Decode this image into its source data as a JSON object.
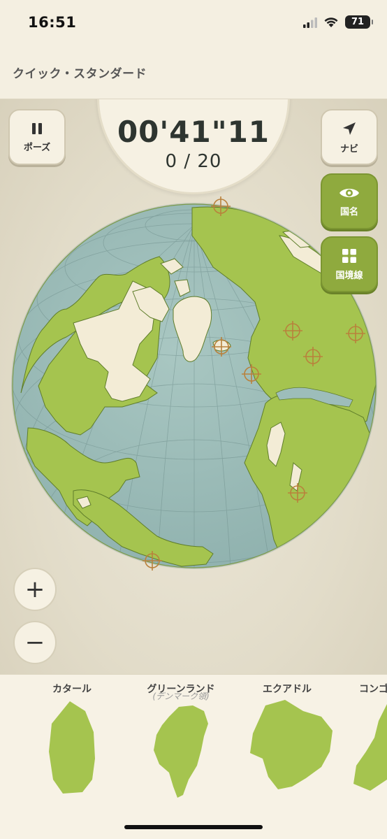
{
  "status_bar": {
    "time": "16:51",
    "battery": "71",
    "icons": [
      "signal-icon",
      "wifi-icon",
      "battery-icon"
    ]
  },
  "header": {
    "mode_title": "クイック・スタンダード"
  },
  "game": {
    "timer": "00'41\"11",
    "progress": "0 / 20",
    "pause_label": "ポーズ",
    "navi_label": "ナビ",
    "country_names_label": "国名",
    "borders_label": "国境線",
    "zoom_in": "+",
    "zoom_out": "−"
  },
  "tray": {
    "cards": [
      {
        "name": "カタール",
        "sub": ""
      },
      {
        "name": "グリーンランド",
        "sub": "(デンマーク領)"
      },
      {
        "name": "エクアドル",
        "sub": ""
      },
      {
        "name": "コンゴ",
        "sub": ""
      }
    ]
  },
  "colors": {
    "ocean": "#9dbdba",
    "land_unplaced": "#a5c44f",
    "land_empty": "#f3ecd6",
    "accent_green": "#8faa3e",
    "background": "#e9e4d3"
  }
}
